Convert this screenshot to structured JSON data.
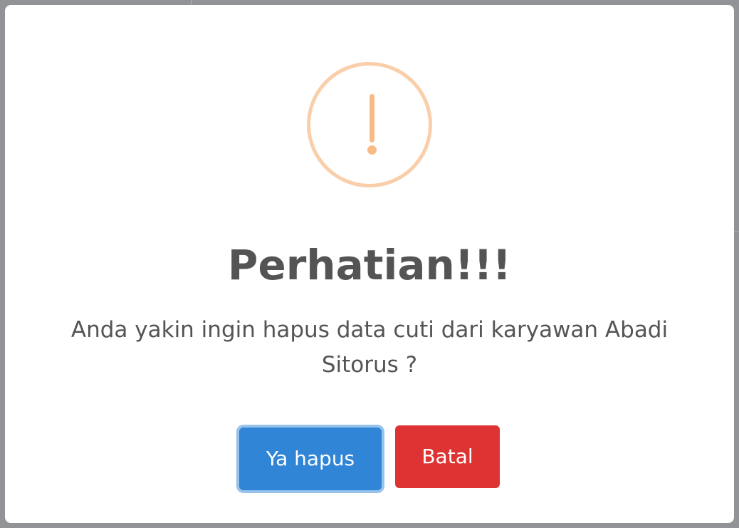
{
  "dialog": {
    "icon": "warning-exclamation-icon",
    "title": "Perhatian!!!",
    "message": "Anda yakin ingin hapus data cuti dari karyawan Abadi Sitorus ?",
    "confirm_label": "Ya hapus",
    "cancel_label": "Batal"
  },
  "colors": {
    "icon_ring": "#facea8",
    "icon_mark": "#f8bb86",
    "confirm": "#3085d6",
    "cancel": "#dd3333",
    "text": "#545454",
    "backdrop": "#929396"
  }
}
